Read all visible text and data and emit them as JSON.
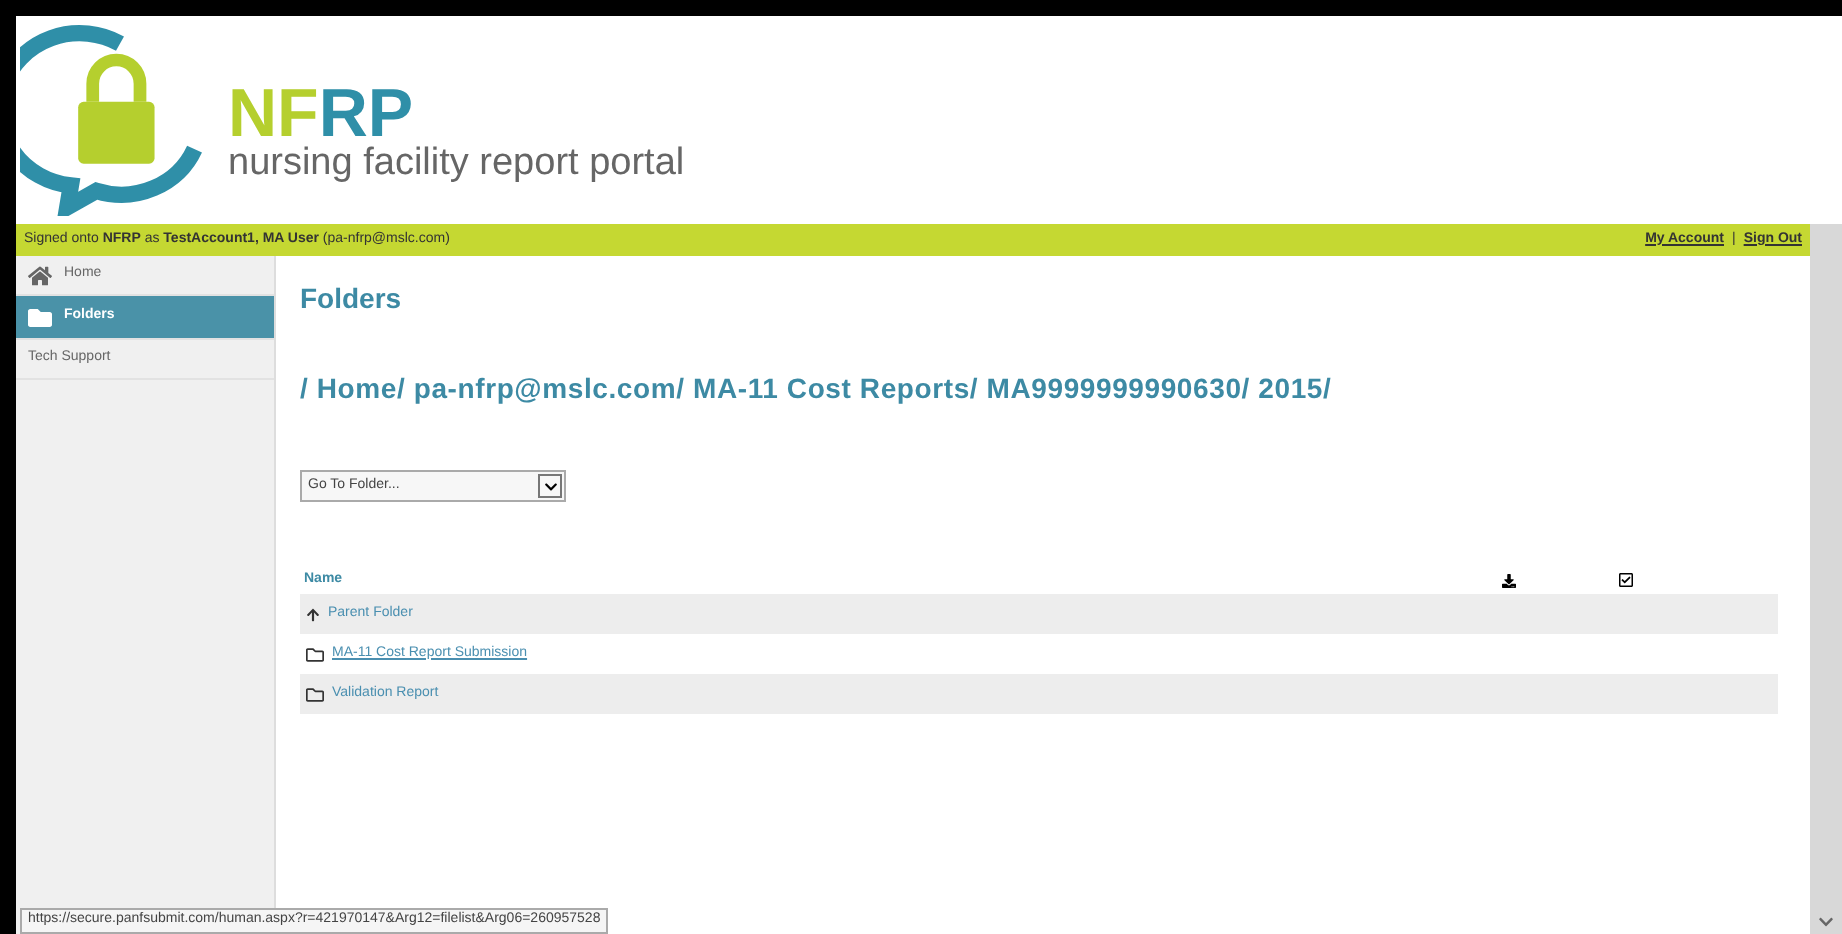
{
  "logo": {
    "mark_green": "NF",
    "mark_blue": "RP",
    "tagline": "nursing facility report portal"
  },
  "account_bar": {
    "signed_in": "Signed onto **NFRP** as **TestAccount1, MA User** (pa-nfrp@mslc.com)",
    "links": [
      "My Account",
      "Sign Out"
    ],
    "separator": "|"
  },
  "sidebar": {
    "items": [
      {
        "label": "Home",
        "kind": "home",
        "selected": false
      },
      {
        "label": "Folders",
        "kind": "folder",
        "selected": true
      },
      {
        "label": "Tech Support",
        "kind": "plain",
        "selected": false
      }
    ]
  },
  "page_title": "Folders",
  "breadcrumb": "/ Home/ pa-nfrp@mslc.com/ MA-11 Cost Reports/ MA9999999990630/ 2015/",
  "folder_select": {
    "placeholder": "Go To Folder..."
  },
  "table": {
    "columns": [
      {
        "kind": "text",
        "label": "Name"
      },
      {
        "kind": "download"
      },
      {
        "kind": "check"
      }
    ],
    "rows": [
      {
        "kind": "parent",
        "name": "Parent Folder",
        "hovered": false
      },
      {
        "kind": "folder",
        "name": "MA-11 Cost Report Submission",
        "hovered": true
      },
      {
        "kind": "folder",
        "name": "Validation Report",
        "hovered": false
      }
    ]
  },
  "status_url": "https://secure.panfsubmit.com/human.aspx?r=421970147&Arg12=filelist&Arg06=260957528"
}
